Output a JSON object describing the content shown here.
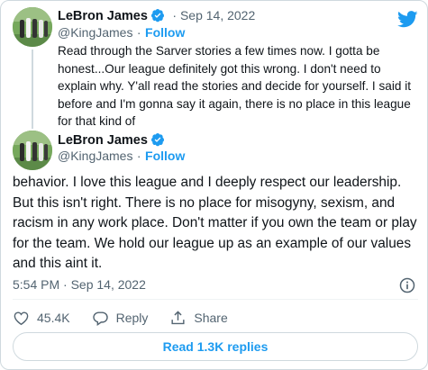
{
  "tweet1": {
    "name": "LeBron James",
    "date": "· Sep 14, 2022",
    "handle": "@KingJames",
    "separator": "·",
    "follow": "Follow",
    "text": "Read through the Sarver stories a few times now. I gotta be honest...Our league definitely got this wrong. I don't need to explain why. Y'all read the stories and decide for yourself. I said it before and I'm gonna say it again, there is no place in this league for that kind of"
  },
  "tweet2": {
    "name": "LeBron James",
    "handle": "@KingJames",
    "separator": "·",
    "follow": "Follow",
    "text": "behavior. I love this league and I deeply respect our leadership. But this isn't right. There is no place for misogyny, sexism, and racism in any work place. Don't matter if you own the team or play for the team. We hold our league up as an example of our values and this aint it.",
    "timestamp": "5:54 PM · Sep 14, 2022"
  },
  "actions": {
    "like_count": "45.4K",
    "reply_label": "Reply",
    "share_label": "Share"
  },
  "replies_button": "Read 1.3K replies",
  "colors": {
    "accent": "#1d9bf0",
    "like": "#536471",
    "text": "#0f1419",
    "secondary": "#536471",
    "border": "#cfd9de"
  },
  "icons": {
    "logo": "twitter-bird-icon",
    "verified": "verified-badge-icon",
    "info": "info-icon",
    "like": "heart-icon",
    "reply": "reply-bubble-icon",
    "share": "share-icon"
  }
}
